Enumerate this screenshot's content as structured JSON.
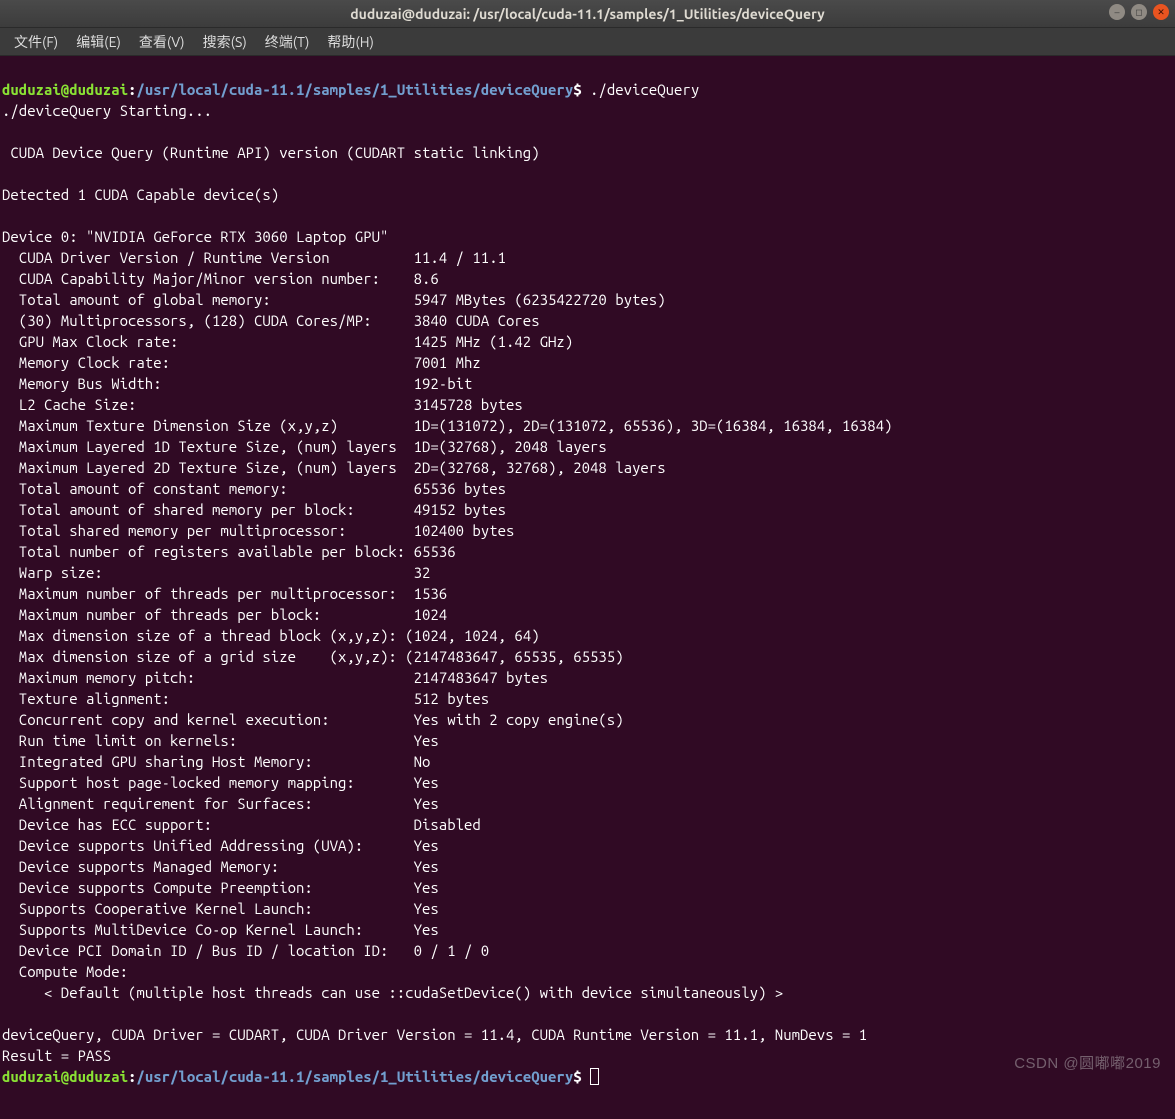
{
  "window": {
    "title": "duduzai@duduzai: /usr/local/cuda-11.1/samples/1_Utilities/deviceQuery"
  },
  "menu": {
    "file": "文件(F)",
    "edit": "编辑(E)",
    "view": "查看(V)",
    "search": "搜索(S)",
    "term": "终端(T)",
    "help": "帮助(H)"
  },
  "prompt": {
    "user": "duduzai@duduzai",
    "colon": ":",
    "path": "/usr/local/cuda-11.1/samples/1_Utilities/deviceQuery",
    "dollar": "$"
  },
  "cmd": "./deviceQuery",
  "out": {
    "l01": "./deviceQuery Starting...",
    "l02": " CUDA Device Query (Runtime API) version (CUDART static linking)",
    "l03": "Detected 1 CUDA Capable device(s)",
    "l04": "Device 0: \"NVIDIA GeForce RTX 3060 Laptop GPU\"",
    "l05": "  CUDA Driver Version / Runtime Version          11.4 / 11.1",
    "l06": "  CUDA Capability Major/Minor version number:    8.6",
    "l07": "  Total amount of global memory:                 5947 MBytes (6235422720 bytes)",
    "l08": "  (30) Multiprocessors, (128) CUDA Cores/MP:     3840 CUDA Cores",
    "l09": "  GPU Max Clock rate:                            1425 MHz (1.42 GHz)",
    "l10": "  Memory Clock rate:                             7001 Mhz",
    "l11": "  Memory Bus Width:                              192-bit",
    "l12": "  L2 Cache Size:                                 3145728 bytes",
    "l13": "  Maximum Texture Dimension Size (x,y,z)         1D=(131072), 2D=(131072, 65536), 3D=(16384, 16384, 16384)",
    "l14": "  Maximum Layered 1D Texture Size, (num) layers  1D=(32768), 2048 layers",
    "l15": "  Maximum Layered 2D Texture Size, (num) layers  2D=(32768, 32768), 2048 layers",
    "l16": "  Total amount of constant memory:               65536 bytes",
    "l17": "  Total amount of shared memory per block:       49152 bytes",
    "l18": "  Total shared memory per multiprocessor:        102400 bytes",
    "l19": "  Total number of registers available per block: 65536",
    "l20": "  Warp size:                                     32",
    "l21": "  Maximum number of threads per multiprocessor:  1536",
    "l22": "  Maximum number of threads per block:           1024",
    "l23": "  Max dimension size of a thread block (x,y,z): (1024, 1024, 64)",
    "l24": "  Max dimension size of a grid size    (x,y,z): (2147483647, 65535, 65535)",
    "l25": "  Maximum memory pitch:                          2147483647 bytes",
    "l26": "  Texture alignment:                             512 bytes",
    "l27": "  Concurrent copy and kernel execution:          Yes with 2 copy engine(s)",
    "l28": "  Run time limit on kernels:                     Yes",
    "l29": "  Integrated GPU sharing Host Memory:            No",
    "l30": "  Support host page-locked memory mapping:       Yes",
    "l31": "  Alignment requirement for Surfaces:            Yes",
    "l32": "  Device has ECC support:                        Disabled",
    "l33": "  Device supports Unified Addressing (UVA):      Yes",
    "l34": "  Device supports Managed Memory:                Yes",
    "l35": "  Device supports Compute Preemption:            Yes",
    "l36": "  Supports Cooperative Kernel Launch:            Yes",
    "l37": "  Supports MultiDevice Co-op Kernel Launch:      Yes",
    "l38": "  Device PCI Domain ID / Bus ID / location ID:   0 / 1 / 0",
    "l39": "  Compute Mode:",
    "l40": "     < Default (multiple host threads can use ::cudaSetDevice() with device simultaneously) >",
    "l41": "deviceQuery, CUDA Driver = CUDART, CUDA Driver Version = 11.4, CUDA Runtime Version = 11.1, NumDevs = 1",
    "l42": "Result = PASS"
  },
  "watermark": "CSDN @圆嘟嘟2019"
}
